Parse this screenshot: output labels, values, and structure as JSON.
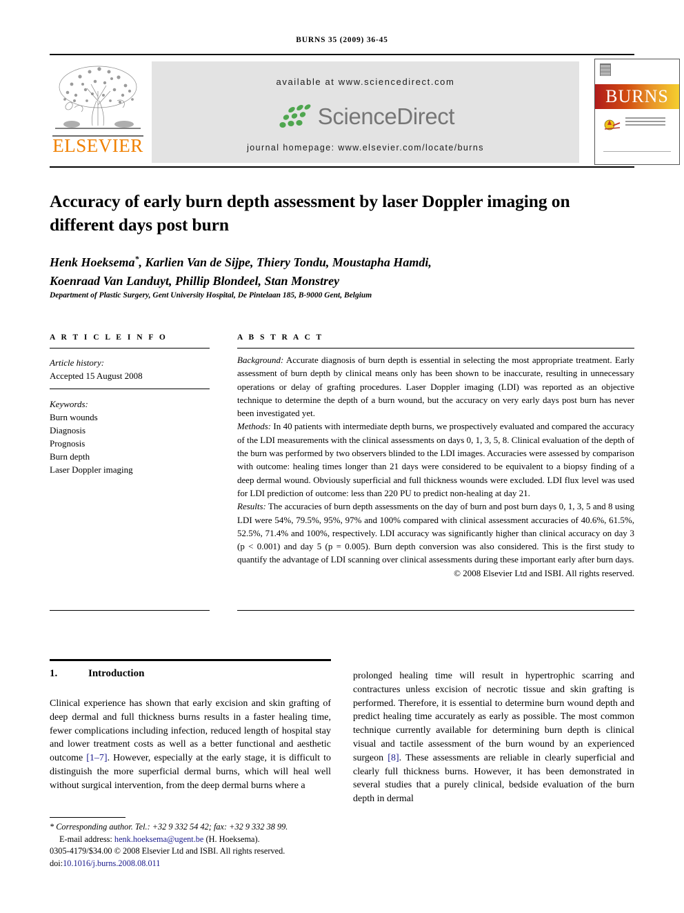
{
  "running_head": "BURNS 35 (2009) 36-45",
  "masthead": {
    "publisher_name": "ELSEVIER",
    "publisher_logo_icon": "elsevier-tree-icon",
    "available_at": "available at www.sciencedirect.com",
    "sciencedirect_wordmark": "ScienceDirect",
    "sciencedirect_icon": "sciencedirect-leaves-icon",
    "journal_homepage": "journal homepage: www.elsevier.com/locate/burns",
    "cover_title": "BURNS",
    "cover_society_icon": "isbi-society-icon",
    "cover_thumb_icon": "journal-cover-thumbnail"
  },
  "article": {
    "title": "Accuracy of early burn depth assessment by laser Doppler imaging on different days post burn",
    "authors": "Henk Hoeksema*, Karlien Van de Sijpe, Thiery Tondu, Moustapha Hamdi, Koenraad Van Landuyt, Phillip Blondeel, Stan Monstrey",
    "author_line_1": "Henk Hoeksema",
    "author_marker": "*",
    "author_line_1_rest": ", Karlien Van de Sijpe, Thiery Tondu, Moustapha Hamdi,",
    "author_line_2": "Koenraad Van Landuyt, Phillip Blondeel, Stan Monstrey",
    "affiliation": "Department of Plastic Surgery, Gent University Hospital, De Pintelaan 185, B-9000 Gent, Belgium"
  },
  "article_info": {
    "heading": "A R T I C L E   I N F O",
    "history_label": "Article history:",
    "history_value": "Accepted 15 August 2008",
    "keywords_label": "Keywords:",
    "keywords": [
      "Burn wounds",
      "Diagnosis",
      "Prognosis",
      "Burn depth",
      "Laser Doppler imaging"
    ]
  },
  "abstract": {
    "heading": "A B S T R A C T",
    "background_label": "Background:",
    "background_text": " Accurate diagnosis of burn depth is essential in selecting the most appropriate treatment. Early assessment of burn depth by clinical means only has been shown to be inaccurate, resulting in unnecessary operations or delay of grafting procedures. Laser Doppler imaging (LDI) was reported as an objective technique to determine the depth of a burn wound, but the accuracy on very early days post burn has never been investigated yet.",
    "methods_label": "Methods:",
    "methods_text": " In 40 patients with intermediate depth burns, we prospectively evaluated and compared the accuracy of the LDI measurements with the clinical assessments on days 0, 1, 3, 5, 8. Clinical evaluation of the depth of the burn was performed by two observers blinded to the LDI images. Accuracies were assessed by comparison with outcome: healing times longer than 21 days were considered to be equivalent to a biopsy finding of a deep dermal wound. Obviously superficial and full thickness wounds were excluded. LDI flux level was used for LDI prediction of outcome: less than 220 PU to predict non-healing at day 21.",
    "results_label": "Results:",
    "results_text": " The accuracies of burn depth assessments on the day of burn and post burn days 0, 1, 3, 5 and 8 using LDI were 54%, 79.5%, 95%, 97% and 100% compared with clinical assessment accuracies of 40.6%, 61.5%, 52.5%, 71.4% and 100%, respectively. LDI accuracy was significantly higher than clinical accuracy on day 3 (p < 0.001) and day 5 (p = 0.005). Burn depth conversion was also considered. This is the first study to quantify the advantage of LDI scanning over clinical assessments during these important early after burn days.",
    "copyright": "© 2008 Elsevier Ltd and ISBI. All rights reserved."
  },
  "introduction": {
    "number": "1.",
    "heading": "Introduction",
    "left_part_1": "Clinical experience has shown that early excision and skin grafting of deep dermal and full thickness burns results in a faster healing time, fewer complications including infection, reduced length of hospital stay and lower treatment costs as well as a better functional and aesthetic outcome ",
    "left_ref_1": "[1–7]",
    "left_part_2": ". However, especially at the early stage, it is difficult to distinguish the more superficial dermal burns, which will heal well without surgical intervention, from the deep dermal burns where a",
    "right_part_1": "prolonged healing time will result in hypertrophic scarring and contractures unless excision of necrotic tissue and skin grafting is performed. Therefore, it is essential to determine burn wound depth and predict healing time accurately as early as possible. The most common technique currently available for determining burn depth is clinical visual and tactile assessment of the burn wound by an experienced surgeon ",
    "right_ref_1": "[8]",
    "right_part_2": ". These assessments are reliable in clearly superficial and clearly full thickness burns. However, it has been demonstrated in several studies that a purely clinical, bedside evaluation of the burn depth in dermal"
  },
  "footnote": {
    "marker": "*",
    "corresponding": "Corresponding author. Tel.: +32 9 332 54 42; fax: +32 9 332 38 99.",
    "email_label": "E-mail address:",
    "email": "henk.hoeksema@ugent.be",
    "email_owner": "(H. Hoeksema).",
    "issn_line": "0305-4179/$34.00 © 2008 Elsevier Ltd and ISBI. All rights reserved.",
    "doi_label": "doi:",
    "doi": "10.1016/j.burns.2008.08.011"
  },
  "colors": {
    "elsevier_orange": "#F08000",
    "sciencedirect_green": "#4FA64F",
    "sciencedirect_gray": "#767676",
    "link_blue": "#1a1a8c",
    "banner_gray": "#e3e3e3"
  }
}
